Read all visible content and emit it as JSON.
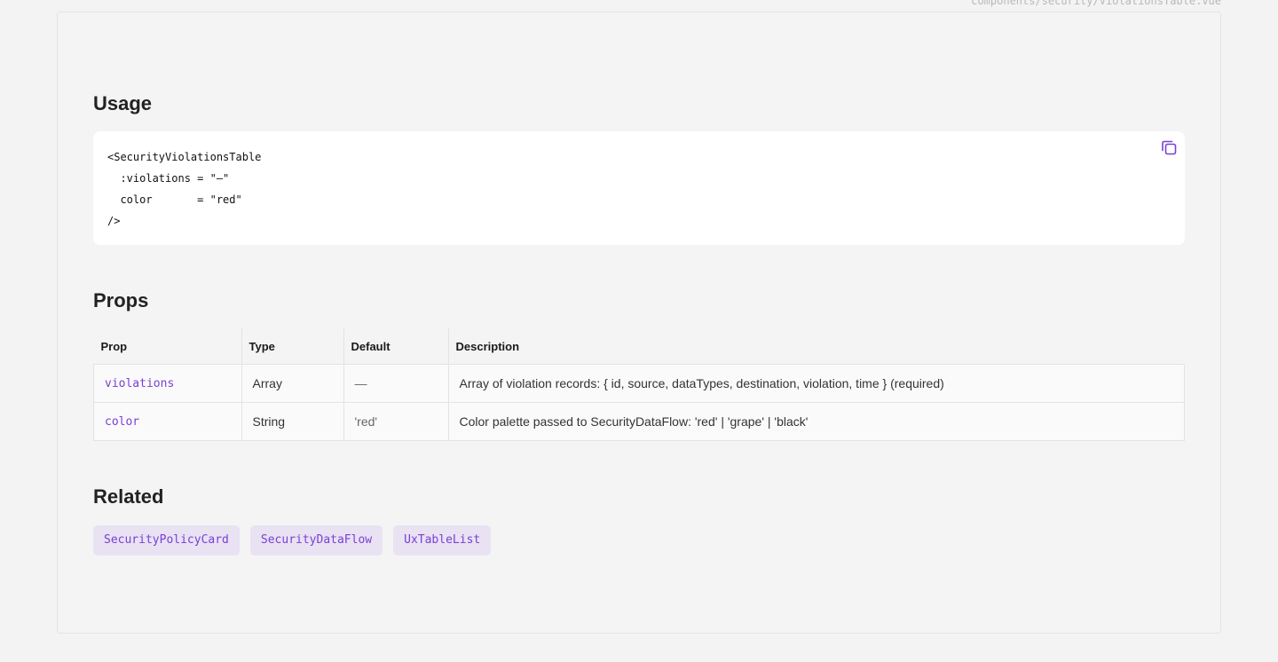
{
  "file_path": "components/security/ViolationsTable.vue",
  "usage": {
    "title": "Usage",
    "code": "<SecurityViolationsTable\n  :violations = \"—\"\n  color       = \"red\"\n/>",
    "copy_icon": "copy-icon"
  },
  "props": {
    "title": "Props",
    "headers": [
      "Prop",
      "Type",
      "Default",
      "Description"
    ],
    "rows": [
      {
        "prop": "violations",
        "type": "Array",
        "default": "—",
        "description": "Array of violation records: { id, source, dataTypes, destination, violation, time } (required)"
      },
      {
        "prop": "color",
        "type": "String",
        "default": "'red'",
        "description": "Color palette passed to SecurityDataFlow: 'red' | 'grape' | 'black'"
      }
    ]
  },
  "related": {
    "title": "Related",
    "items": [
      "SecurityPolicyCard",
      "SecurityDataFlow",
      "UxTableList"
    ]
  },
  "colors": {
    "accent": "#7b3fd6",
    "chip_bg": "#e8e2f3",
    "page_bg": "#f3f3f3"
  }
}
